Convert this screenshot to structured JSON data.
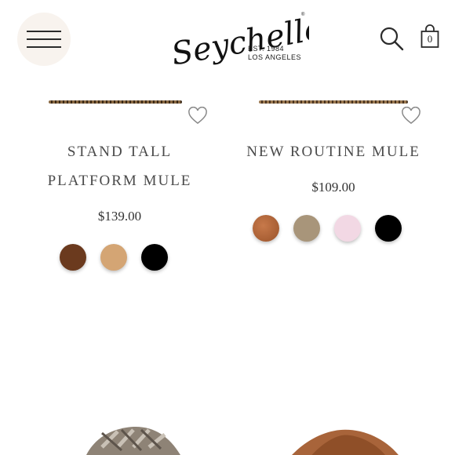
{
  "header": {
    "brand_name": "Seychelles",
    "brand_est": "EST. 1984",
    "brand_location": "LOS ANGELES",
    "cart_count": "0",
    "menu_icon": "hamburger-menu-icon",
    "search_icon": "search-icon",
    "bag_icon": "shopping-bag-icon"
  },
  "products": [
    {
      "name_line1": "STAND TALL",
      "name_line2": "PLATFORM MULE",
      "price": "$139.00",
      "wishlist_icon": "heart-icon",
      "swatches": [
        "#6b3a1e",
        "#d4a574",
        "#000000"
      ]
    },
    {
      "name_line1": "NEW ROUTINE MULE",
      "price": "$109.00",
      "wishlist_icon": "heart-icon",
      "swatches": [
        "#b8693f",
        "#a8957a",
        "#f2d8e4",
        "#000000"
      ]
    }
  ],
  "colors": {
    "menu_button_bg": "#f8f3ee",
    "text_dark": "#333333",
    "product_name": "#4a4a4a"
  }
}
